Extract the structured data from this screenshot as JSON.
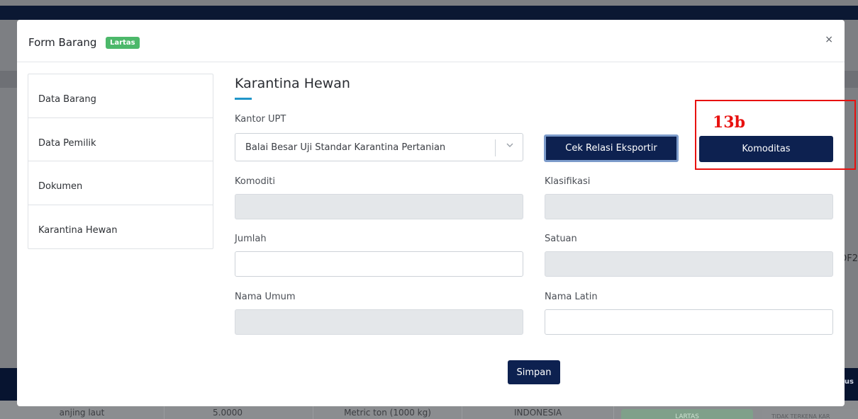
{
  "background": {
    "table_row": [
      "anjing laut",
      "5.0000",
      "Metric ton (1000 kg)",
      "INDONESIA"
    ],
    "status_badge": "LARTAS",
    "status_badge_2": "TIDAK TERKENA KAR",
    "header_right_text": "us",
    "side_text": "DF2"
  },
  "modal": {
    "title": "Form Barang",
    "badge": "Lartas",
    "close_symbol": "×"
  },
  "nav": {
    "items": [
      {
        "label": "Data Barang"
      },
      {
        "label": "Data Pemilik"
      },
      {
        "label": "Dokumen"
      },
      {
        "label": "Karantina Hewan"
      }
    ]
  },
  "section": {
    "title": "Karantina Hewan"
  },
  "form": {
    "kantor_upt": {
      "label": "Kantor UPT",
      "value": "Balai Besar Uji Standar Karantina Pertanian"
    },
    "cek_relasi_label": "Cek Relasi Eksportir",
    "komoditas_label": "Komoditas",
    "komoditi": {
      "label": "Komoditi",
      "value": ""
    },
    "klasifikasi": {
      "label": "Klasifikasi",
      "value": ""
    },
    "jumlah": {
      "label": "Jumlah",
      "value": ""
    },
    "satuan": {
      "label": "Satuan",
      "value": ""
    },
    "nama_umum": {
      "label": "Nama Umum",
      "value": ""
    },
    "nama_latin": {
      "label": "Nama Latin",
      "value": ""
    },
    "simpan_label": "Simpan"
  },
  "annotation": {
    "label": "13b",
    "color": "#e8110f"
  },
  "colors": {
    "primary_button": "#0d2150",
    "badge_green": "#4cb86a",
    "accent_underline": "#2196c9"
  }
}
